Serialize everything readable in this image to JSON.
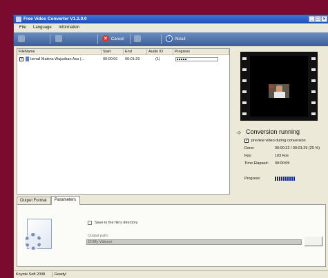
{
  "window": {
    "title": "Free Video Converter V1.2.0.0"
  },
  "menu": [
    "File",
    "Language",
    "Information"
  ],
  "toolbar": {
    "cancel_label": "Cancel",
    "about_label": "About"
  },
  "file_list": {
    "columns": [
      "FileName",
      "Start",
      "End",
      "Audio ID",
      "Progress"
    ],
    "rows": [
      {
        "checked": true,
        "filename": "Ismail Makina Wujudkan Asa (...",
        "start": "00:00:00",
        "end": "00:01:29",
        "audio_id": "(1)",
        "progress": 0.25
      }
    ]
  },
  "preview": {
    "status": "Conversion running",
    "preview_checkbox_label": "preview video during conversion",
    "preview_checked": true,
    "stats": [
      {
        "label": "Done:",
        "value": "00:00:22 / 00:01:29  (25 %)"
      },
      {
        "label": "Fps:",
        "value": "103 Fps"
      },
      {
        "label": "Time Elapsed:",
        "value": "00:00:05"
      }
    ],
    "progress_label": "Progress:",
    "progress": 0.25
  },
  "tabs": [
    "Output Format",
    "Parameters"
  ],
  "active_tab": "Parameters",
  "parameters": {
    "save_in_dir_label": "Save in the file's directory",
    "save_in_dir_checked": false,
    "output_path_label": "Output path:",
    "output_path_value": "D:\\My Videos\\"
  },
  "statusbar": {
    "left": "Koyote Soft 2008",
    "right": "Ready!"
  },
  "colors": {
    "titlebar": "#1f4fb8",
    "toolbar": "#3c5e98",
    "progress": "#0a2a9a",
    "background": "#7a0b2e"
  }
}
